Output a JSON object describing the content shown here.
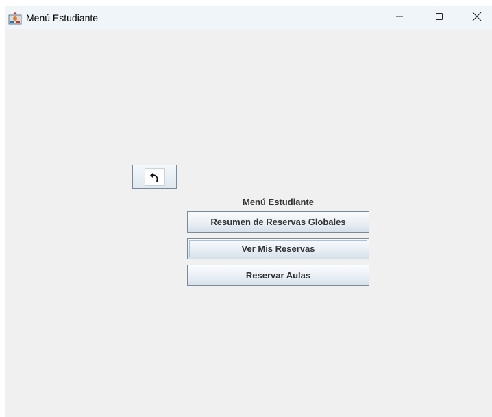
{
  "window": {
    "title": "Menú Estudiante",
    "icon": "java-app-icon",
    "controls": {
      "minimize": "minimize-icon",
      "maximize": "maximize-icon",
      "close": "close-icon"
    }
  },
  "main": {
    "back_button_icon": "back-arrow-icon",
    "menu_title": "Menú Estudiante",
    "buttons": [
      {
        "label": "Resumen de Reservas Globales"
      },
      {
        "label": "Ver Mis Reservas"
      },
      {
        "label": "Reservar Aulas"
      }
    ]
  },
  "colors": {
    "window_bg": "#f0f0f0",
    "titlebar_bg": "#eff5f9",
    "button_border": "#7a8a99",
    "button_text": "#333333"
  }
}
